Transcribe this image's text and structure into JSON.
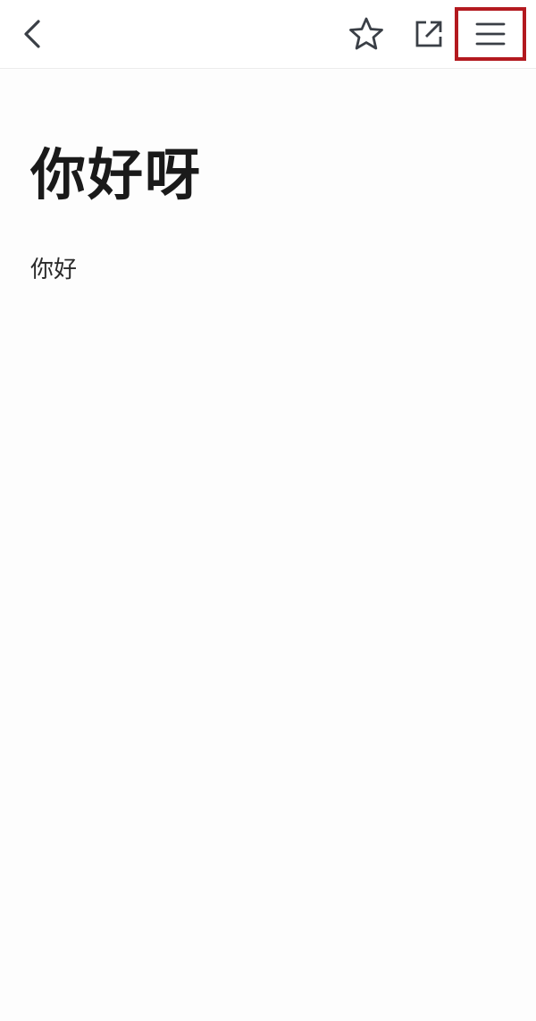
{
  "toolbar": {
    "icons": {
      "back": "chevron-left-icon",
      "favorite": "star-outline-icon",
      "share": "external-link-icon",
      "menu": "hamburger-menu-icon"
    },
    "icon_color": "#3a3f46",
    "highlight_color": "#b3191f"
  },
  "note": {
    "title": "你好呀",
    "body": "你好"
  }
}
